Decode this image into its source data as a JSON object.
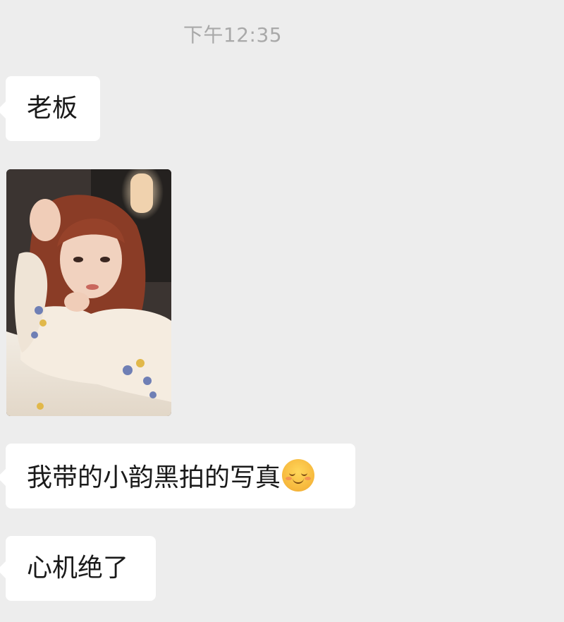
{
  "chat": {
    "timestamp": "下午12:35",
    "messages": [
      {
        "type": "text",
        "text": "老板"
      },
      {
        "type": "image",
        "description_icon": "photo-message"
      },
      {
        "type": "text",
        "text": "我带的小韵黑拍的写真",
        "emoji": "relieved-face-emoji"
      },
      {
        "type": "text",
        "text": "心机绝了"
      }
    ]
  },
  "colors": {
    "background": "#ededed",
    "bubble": "#ffffff",
    "timestamp": "#a9a9a9",
    "text": "#1a1a1a"
  }
}
